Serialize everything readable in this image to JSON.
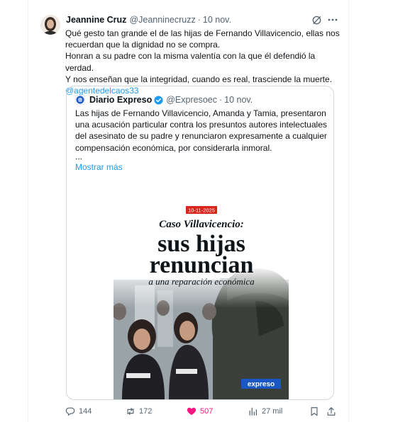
{
  "tweet": {
    "display_name": "Jeannine Cruz",
    "handle": "@Jeanninecruzz",
    "separator": "·",
    "date": "10 nov.",
    "lines": [
      "Qué gesto tan grande el de las hijas de Fernando Villavicencio, ellas nos",
      "recuerdan que la dignidad no se compra.",
      "Honran a su padre con la misma valentía con la que él defendió la verdad.",
      "Y nos enseñan que la integridad, cuando es real, trasciende la muerte."
    ],
    "mention": "@agentedelcaos33"
  },
  "quoted": {
    "display_name": "Diario Expreso",
    "handle": "@Expresoec",
    "separator": "·",
    "date": "10 nov.",
    "text": "Las hijas de Fernando Villavicencio, Amanda y Tamia, presentaron una acusación particular contra los presuntos autores intelectuales del asesinato de su padre y renunciaron expresamente a cualquier compensación económica, por considerarla inmoral.",
    "ellipsis": "...",
    "show_more": "Mostrar más",
    "image": {
      "date_badge": "10-11-2025",
      "kicker": "Caso Villavicencio:",
      "headline_1": "sus hijas",
      "headline_2": "renuncian",
      "subline": "a una reparación económica",
      "brand": "expreso"
    }
  },
  "actions": {
    "replies": "144",
    "reposts": "172",
    "likes": "507",
    "views": "27 mil"
  },
  "icons": [
    "avatar",
    "grok-icon",
    "more-icon",
    "expreso-logo-icon",
    "verified-badge-icon",
    "reply-icon",
    "repost-icon",
    "like-icon",
    "views-icon",
    "bookmark-icon",
    "share-icon"
  ],
  "colors": {
    "accent": "#1d9bf0",
    "like": "#f91880",
    "muted": "#536471",
    "border": "#cfd9de",
    "badge_red": "#d9261c"
  }
}
